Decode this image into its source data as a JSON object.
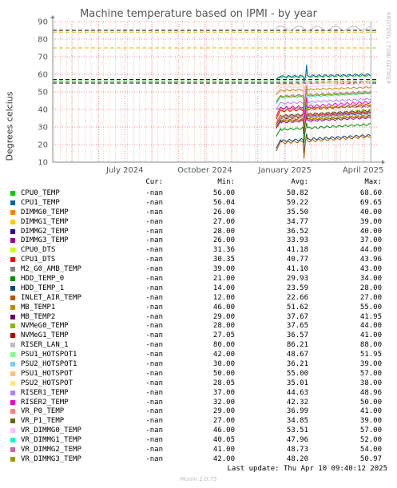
{
  "side_text": "RRDTOOL / TOBI OETIKER",
  "last_update": "Last update: Thu Apr 10 09:40:12 2025",
  "footer": "Munin 2.0.75",
  "legend_header": {
    "cur": "Cur:",
    "min": "Min:",
    "avg": "Avg:",
    "max": "Max:"
  },
  "chart_data": {
    "type": "line",
    "title": "Machine temperature based on IPMI - by year",
    "ylabel": "Degrees celcius",
    "ylim": [
      10,
      90
    ],
    "yticks": [
      10,
      20,
      30,
      40,
      50,
      60,
      70,
      80,
      90
    ],
    "xlabels": [
      "July 2024",
      "October 2024",
      "January 2025",
      "April 2025"
    ],
    "x_range": [
      "2024-04-09",
      "2025-04-17"
    ],
    "data_start": "2024-12-22",
    "data_end": "2025-04-10",
    "grid": true,
    "threshold_lines": [
      {
        "value": 85,
        "color": "#000000"
      },
      {
        "value": 84,
        "color": "#d6c000"
      },
      {
        "value": 75,
        "color": "#d6c000"
      },
      {
        "value": 57,
        "color": "#000000"
      },
      {
        "value": 55,
        "color": "#000000"
      },
      {
        "value": 56,
        "color": "#00c000"
      }
    ],
    "series": [
      {
        "name": "CPU0_TEMP",
        "color": "#00cc00",
        "cur": "-nan",
        "min": "56.00",
        "avg": "58.82",
        "max": "68.60"
      },
      {
        "name": "CPU1_TEMP",
        "color": "#0066b3",
        "cur": "-nan",
        "min": "56.04",
        "avg": "59.22",
        "max": "69.65"
      },
      {
        "name": "DIMMG0_TEMP",
        "color": "#ff8000",
        "cur": "-nan",
        "min": "26.00",
        "avg": "35.50",
        "max": "40.00"
      },
      {
        "name": "DIMMG1_TEMP",
        "color": "#ffcc00",
        "cur": "-nan",
        "min": "27.00",
        "avg": "34.77",
        "max": "39.00"
      },
      {
        "name": "DIMMG2_TEMP",
        "color": "#330099",
        "cur": "-nan",
        "min": "28.00",
        "avg": "36.52",
        "max": "40.00"
      },
      {
        "name": "DIMMG3_TEMP",
        "color": "#990099",
        "cur": "-nan",
        "min": "26.00",
        "avg": "33.93",
        "max": "37.00"
      },
      {
        "name": "CPU0_DTS",
        "color": "#ccff00",
        "cur": "-nan",
        "min": "31.36",
        "avg": "41.18",
        "max": "44.00"
      },
      {
        "name": "CPU1_DTS",
        "color": "#ff0000",
        "cur": "-nan",
        "min": "30.35",
        "avg": "40.77",
        "max": "43.96"
      },
      {
        "name": "M2_G0_AMB_TEMP",
        "color": "#808080",
        "cur": "-nan",
        "min": "39.00",
        "avg": "41.10",
        "max": "43.00"
      },
      {
        "name": "HDD_TEMP_0",
        "color": "#008f00",
        "cur": "-nan",
        "min": "21.00",
        "avg": "29.93",
        "max": "34.00"
      },
      {
        "name": "HDD_TEMP_1",
        "color": "#00487d",
        "cur": "-nan",
        "min": "14.00",
        "avg": "23.59",
        "max": "28.00"
      },
      {
        "name": "INLET_AIR_TEMP",
        "color": "#b35a00",
        "cur": "-nan",
        "min": "12.00",
        "avg": "22.66",
        "max": "27.00"
      },
      {
        "name": "MB_TEMP1",
        "color": "#b38f00",
        "cur": "-nan",
        "min": "46.00",
        "avg": "51.62",
        "max": "55.00"
      },
      {
        "name": "MB_TEMP2",
        "color": "#6b006b",
        "cur": "-nan",
        "min": "29.00",
        "avg": "37.67",
        "max": "41.95"
      },
      {
        "name": "NVMeG0_TEMP",
        "color": "#8fb300",
        "cur": "-nan",
        "min": "28.00",
        "avg": "37.65",
        "max": "44.00"
      },
      {
        "name": "NVMeG1_TEMP",
        "color": "#b30000",
        "cur": "-nan",
        "min": "27.05",
        "avg": "36.57",
        "max": "41.00"
      },
      {
        "name": "RISER_LAN_1",
        "color": "#bebebe",
        "cur": "-nan",
        "min": "80.00",
        "avg": "86.21",
        "max": "88.00"
      },
      {
        "name": "PSU1_HOTSPOT1",
        "color": "#80ff80",
        "cur": "-nan",
        "min": "42.00",
        "avg": "48.67",
        "max": "51.95"
      },
      {
        "name": "PSU2_HOTSPOT1",
        "color": "#80c9ff",
        "cur": "-nan",
        "min": "30.00",
        "avg": "36.21",
        "max": "39.00"
      },
      {
        "name": "PSU1_HOTSPOT",
        "color": "#ffc080",
        "cur": "-nan",
        "min": "50.00",
        "avg": "55.00",
        "max": "57.00"
      },
      {
        "name": "PSU2_HOTSPOT",
        "color": "#ffe680",
        "cur": "-nan",
        "min": "28.05",
        "avg": "35.01",
        "max": "38.00"
      },
      {
        "name": "RISER1_TEMP",
        "color": "#aa80ff",
        "cur": "-nan",
        "min": "37.00",
        "avg": "44.63",
        "max": "48.96"
      },
      {
        "name": "RISER2_TEMP",
        "color": "#ee00cc",
        "cur": "-nan",
        "min": "32.00",
        "avg": "42.32",
        "max": "50.00"
      },
      {
        "name": "VR_P0_TEMP",
        "color": "#ff8080",
        "cur": "-nan",
        "min": "29.00",
        "avg": "36.99",
        "max": "41.00"
      },
      {
        "name": "VR_P1_TEMP",
        "color": "#666600",
        "cur": "-nan",
        "min": "27.00",
        "avg": "34.85",
        "max": "39.00"
      },
      {
        "name": "VR_DIMMG0_TEMP",
        "color": "#ffbfff",
        "cur": "-nan",
        "min": "46.00",
        "avg": "53.51",
        "max": "57.00"
      },
      {
        "name": "VR_DIMMG1_TEMP",
        "color": "#00ffcc",
        "cur": "-nan",
        "min": "40.05",
        "avg": "47.96",
        "max": "52.00"
      },
      {
        "name": "VR_DIMMG2_TEMP",
        "color": "#cc6699",
        "cur": "-nan",
        "min": "41.00",
        "avg": "48.73",
        "max": "54.00"
      },
      {
        "name": "VR_DIMMG3_TEMP",
        "color": "#999900",
        "cur": "-nan",
        "min": "42.00",
        "avg": "48.20",
        "max": "50.97"
      }
    ]
  }
}
